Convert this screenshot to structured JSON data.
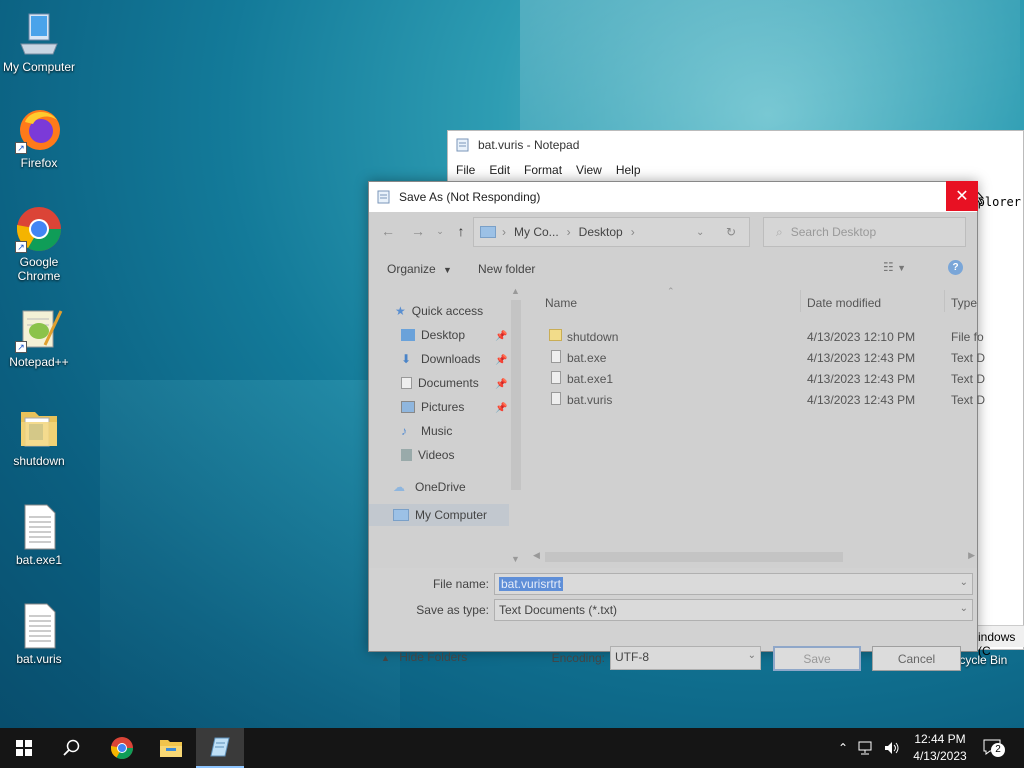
{
  "desktop": {
    "icons": [
      {
        "label": "My Computer",
        "icon": "computer-icon"
      },
      {
        "label": "Firefox",
        "icon": "firefox-icon"
      },
      {
        "label": "Google Chrome",
        "icon": "chrome-icon"
      },
      {
        "label": "Notepad++",
        "icon": "notepadpp-icon"
      },
      {
        "label": "shutdown",
        "icon": "folder-icon"
      },
      {
        "label": "bat.exe1",
        "icon": "document-icon"
      },
      {
        "label": "bat.vuris",
        "icon": "document-icon"
      }
    ],
    "recycle_bin": "Recycle Bin"
  },
  "notepad": {
    "title": "bat.vuris - Notepad",
    "menu": [
      "File",
      "Edit",
      "Format",
      "View",
      "Help"
    ],
    "visible_text": "plorer",
    "status_fragment": "indows (C"
  },
  "dialog": {
    "title": "Save As (Not Responding)",
    "close": "✕",
    "breadcrumb": [
      "My Co...",
      "Desktop"
    ],
    "search_placeholder": "Search Desktop",
    "organize": "Organize",
    "new_folder": "New folder",
    "help": "?",
    "tree": {
      "quick_access": "Quick access",
      "items": [
        "Desktop",
        "Downloads",
        "Documents",
        "Pictures",
        "Music",
        "Videos"
      ],
      "onedrive": "OneDrive",
      "my_computer": "My Computer"
    },
    "columns": [
      "Name",
      "Date modified",
      "Type"
    ],
    "files": [
      {
        "name": "shutdown",
        "date": "4/13/2023 12:10 PM",
        "type": "File fo",
        "kind": "folder"
      },
      {
        "name": "bat.exe",
        "date": "4/13/2023 12:43 PM",
        "type": "Text D",
        "kind": "file"
      },
      {
        "name": "bat.exe1",
        "date": "4/13/2023 12:43 PM",
        "type": "Text D",
        "kind": "file"
      },
      {
        "name": "bat.vuris",
        "date": "4/13/2023 12:43 PM",
        "type": "Text D",
        "kind": "file"
      }
    ],
    "file_name_label": "File name:",
    "file_name_value": "bat.vurisrtrt",
    "save_type_label": "Save as type:",
    "save_type_value": "Text Documents (*.txt)",
    "hide_folders": "Hide Folders",
    "encoding_label": "Encoding:",
    "encoding_value": "UTF-8",
    "save": "Save",
    "cancel": "Cancel"
  },
  "taskbar": {
    "time": "12:44 PM",
    "date": "4/13/2023",
    "notifications": "2"
  }
}
